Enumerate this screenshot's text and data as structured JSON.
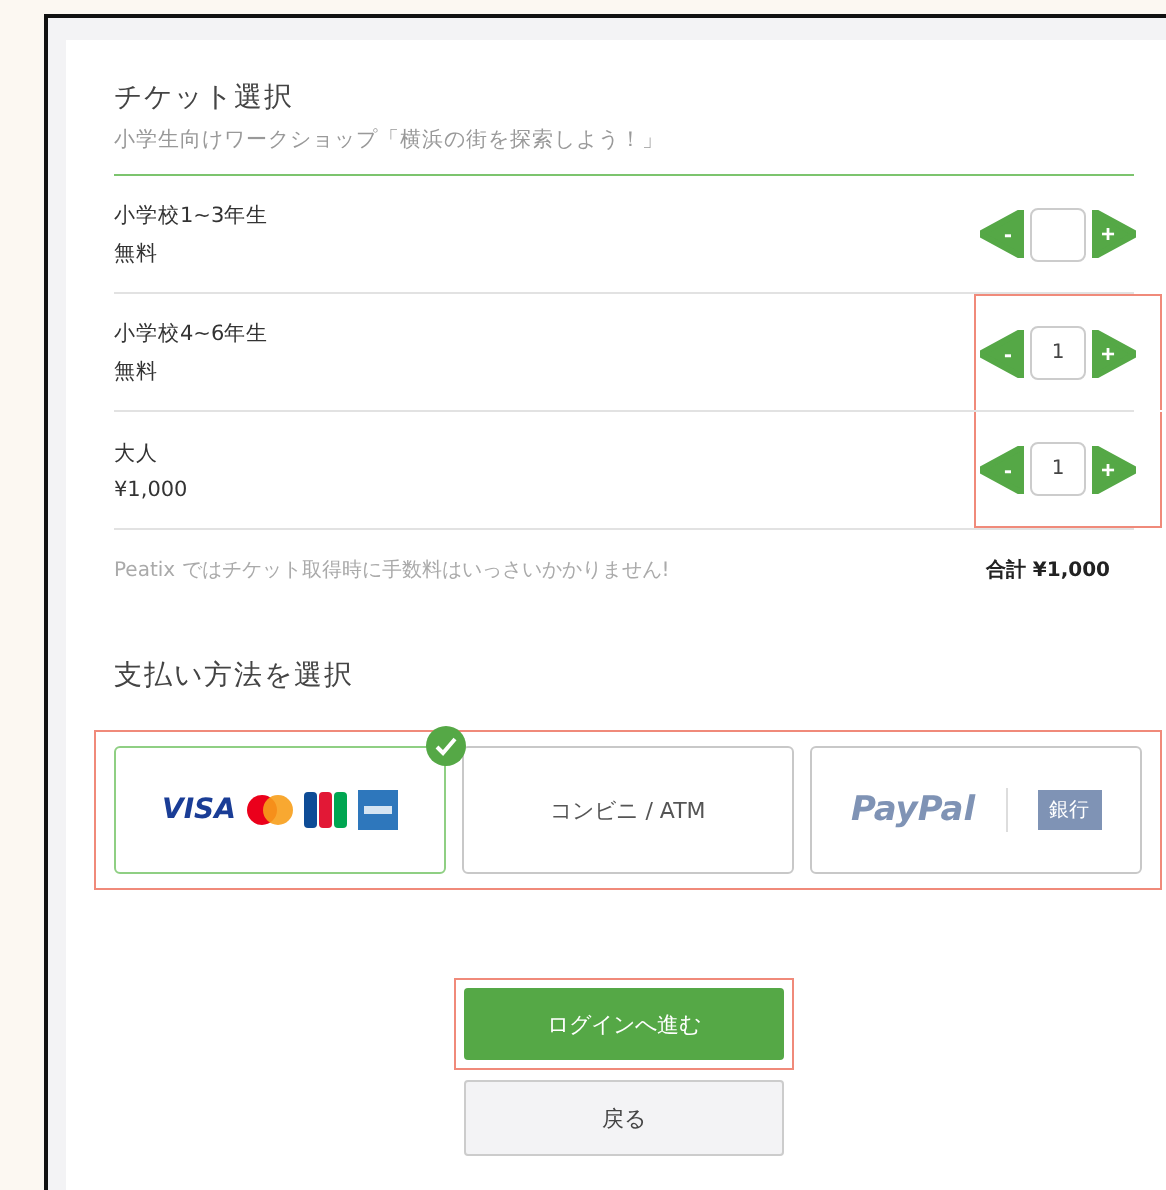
{
  "ticket_section": {
    "title": "チケット選択",
    "subtitle": "小学生向けワークショップ「横浜の街を探索しよう！」"
  },
  "tickets": [
    {
      "name": "小学校1~3年生",
      "price": "無料",
      "minus": "-",
      "plus": "+",
      "highlighted": false
    },
    {
      "name": "小学校4~6年生",
      "price": "無料",
      "quantity": "1",
      "minus": "-",
      "plus": "+",
      "highlighted": true
    },
    {
      "name": "大人",
      "price": "¥1,000",
      "quantity": "1",
      "minus": "-",
      "plus": "+",
      "highlighted": true
    }
  ],
  "fee_note": "Peatix ではチケット取得時に手数料はいっさいかかりません!",
  "total": "合計 ¥1,000",
  "payment_section": {
    "title": "支払い方法を選択",
    "highlighted": true
  },
  "payment_methods": [
    {
      "kind": "card",
      "logo_text": "VISA",
      "selected": true
    },
    {
      "kind": "konbini",
      "label": "コンビニ / ATM",
      "selected": false
    },
    {
      "kind": "paypal",
      "logo_text": "PayPal",
      "badge": "銀行",
      "selected": false
    }
  ],
  "proceed_button": {
    "label": "ログインへ進む",
    "highlighted": true
  },
  "back_button": {
    "label": "戻る"
  }
}
